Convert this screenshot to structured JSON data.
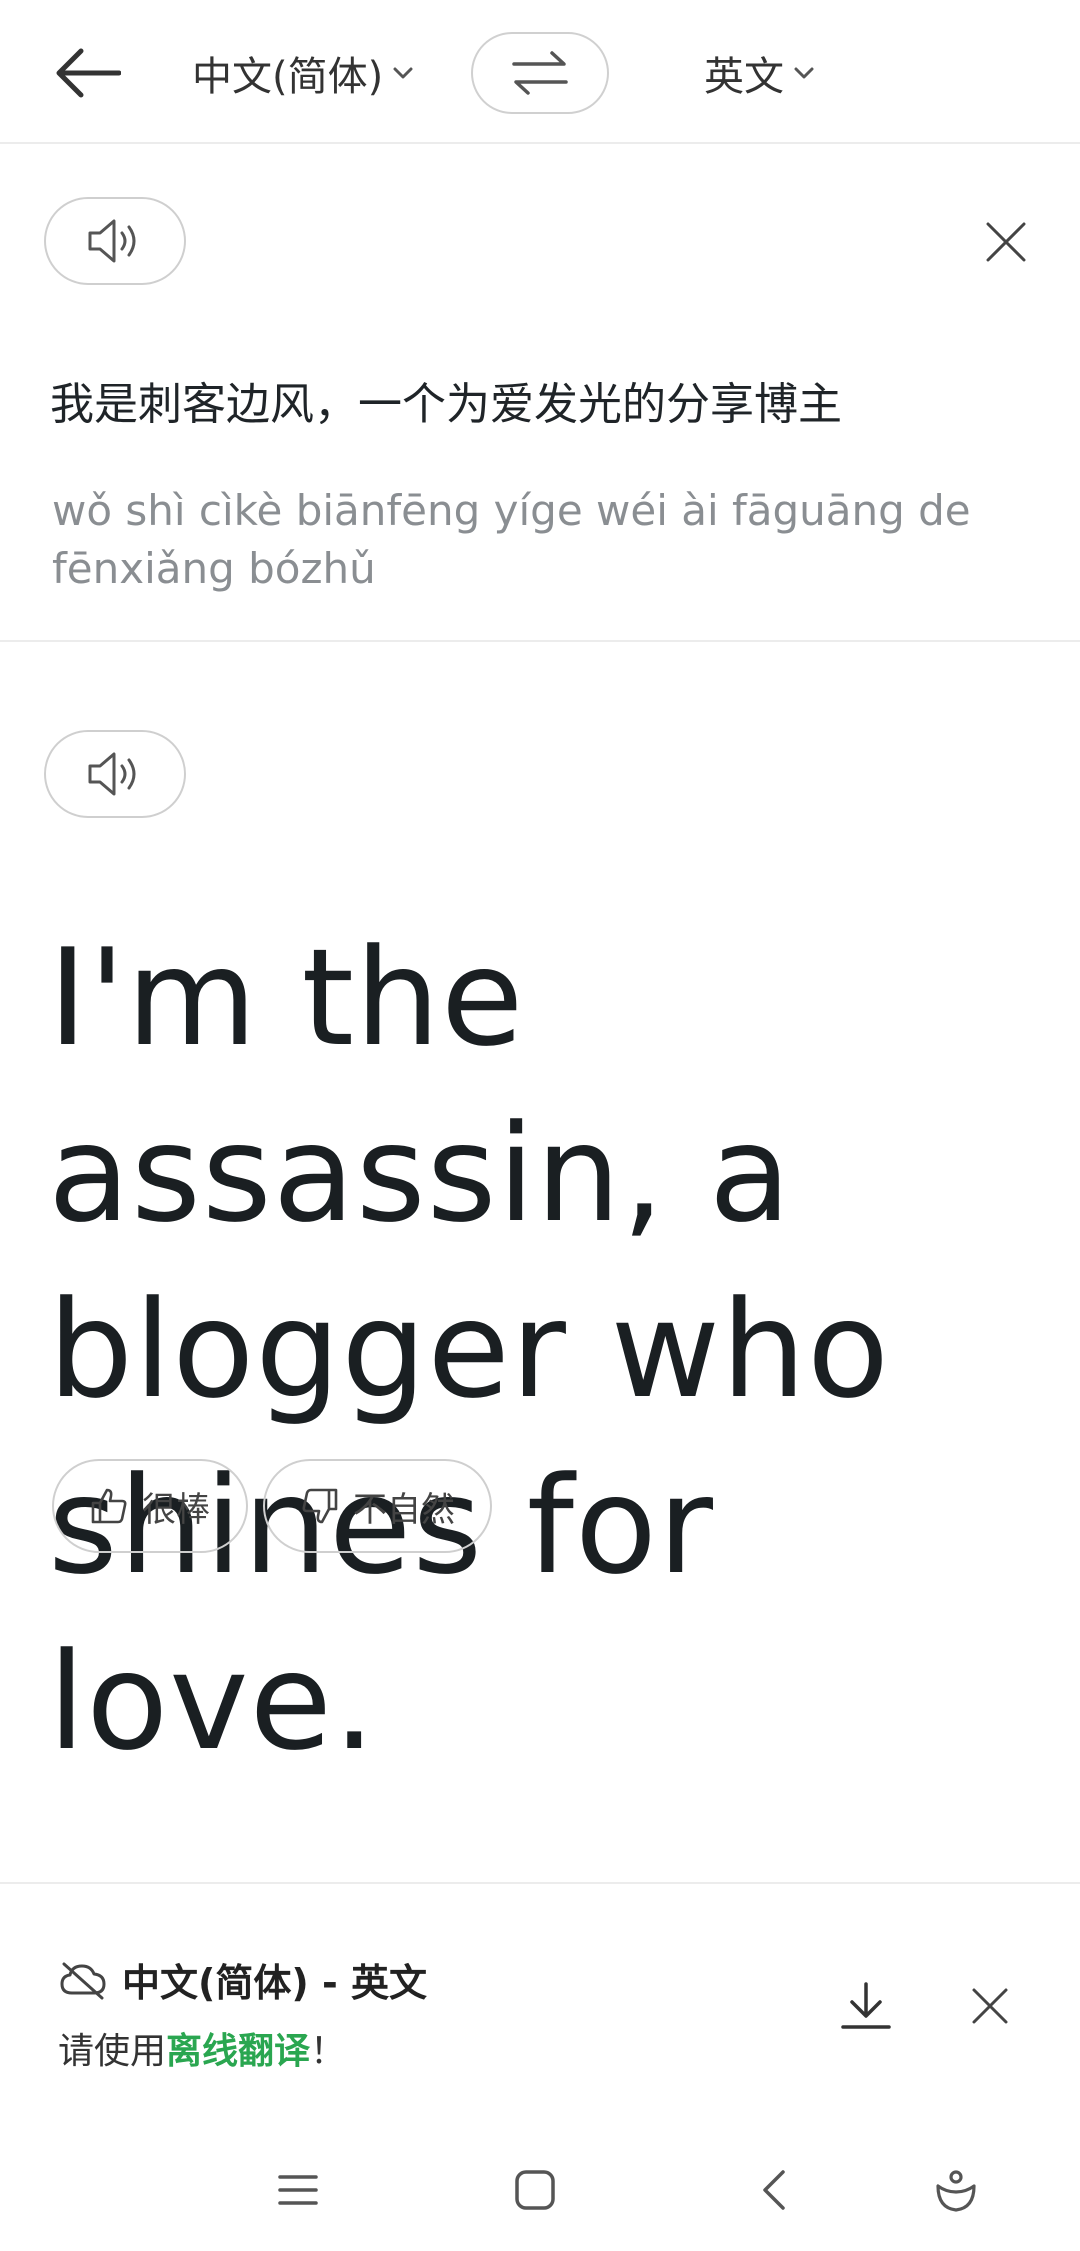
{
  "header": {
    "source_lang": "中文(简体)",
    "target_lang": "英文"
  },
  "source": {
    "text": "我是刺客边风，一个为爱发光的分享博主",
    "pinyin": "wǒ shì cìkè biānfēng yíge wéi ài fāguāng de fēnxiǎng bózhǔ"
  },
  "target": {
    "translation": "I'm the assassin, a blogger who shines for love."
  },
  "feedback": {
    "good_label": "很棒",
    "bad_label": "不自然"
  },
  "offline_banner": {
    "title": "中文(简体) - 英文",
    "prefix": "请使用",
    "link": "离线翻译",
    "suffix": "！"
  },
  "icons": {
    "back": "arrow-left-icon",
    "swap": "swap-arrows-icon",
    "speaker": "speaker-icon",
    "close": "close-icon",
    "thumbs_up": "thumbs-up-icon",
    "thumbs_down": "thumbs-down-icon",
    "cloud_off": "cloud-off-icon",
    "download": "download-icon"
  },
  "colors": {
    "accent_green": "#2aa650",
    "text_primary": "#1f2428",
    "text_muted": "#8a8e92"
  }
}
